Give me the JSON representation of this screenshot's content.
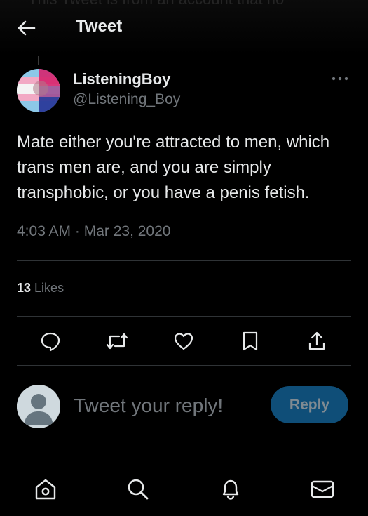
{
  "banner": {
    "text": "This Tweet is from an account that no"
  },
  "header": {
    "title": "Tweet"
  },
  "tweet": {
    "display_name": "ListeningBoy",
    "handle": "@Listening_Boy",
    "text": "Mate either you're attracted to men, which trans men are, and you are simply transphobic, or you have a penis fetish.",
    "timestamp": "4:03 AM · Mar 23, 2020",
    "likes_count": "13",
    "likes_label": "Likes"
  },
  "actions": [
    "reply-icon",
    "retweet-icon",
    "like-icon",
    "bookmark-icon",
    "share-icon"
  ],
  "composer": {
    "placeholder": "Tweet your reply!",
    "button_label": "Reply"
  },
  "bottom_nav": [
    "home-icon",
    "search-icon",
    "notifications-icon",
    "messages-icon"
  ],
  "colors": {
    "background": "#000000",
    "text_primary": "#e7e9ea",
    "text_secondary": "#71767b",
    "divider": "#2f3336",
    "reply_button": "#0f4e78"
  }
}
